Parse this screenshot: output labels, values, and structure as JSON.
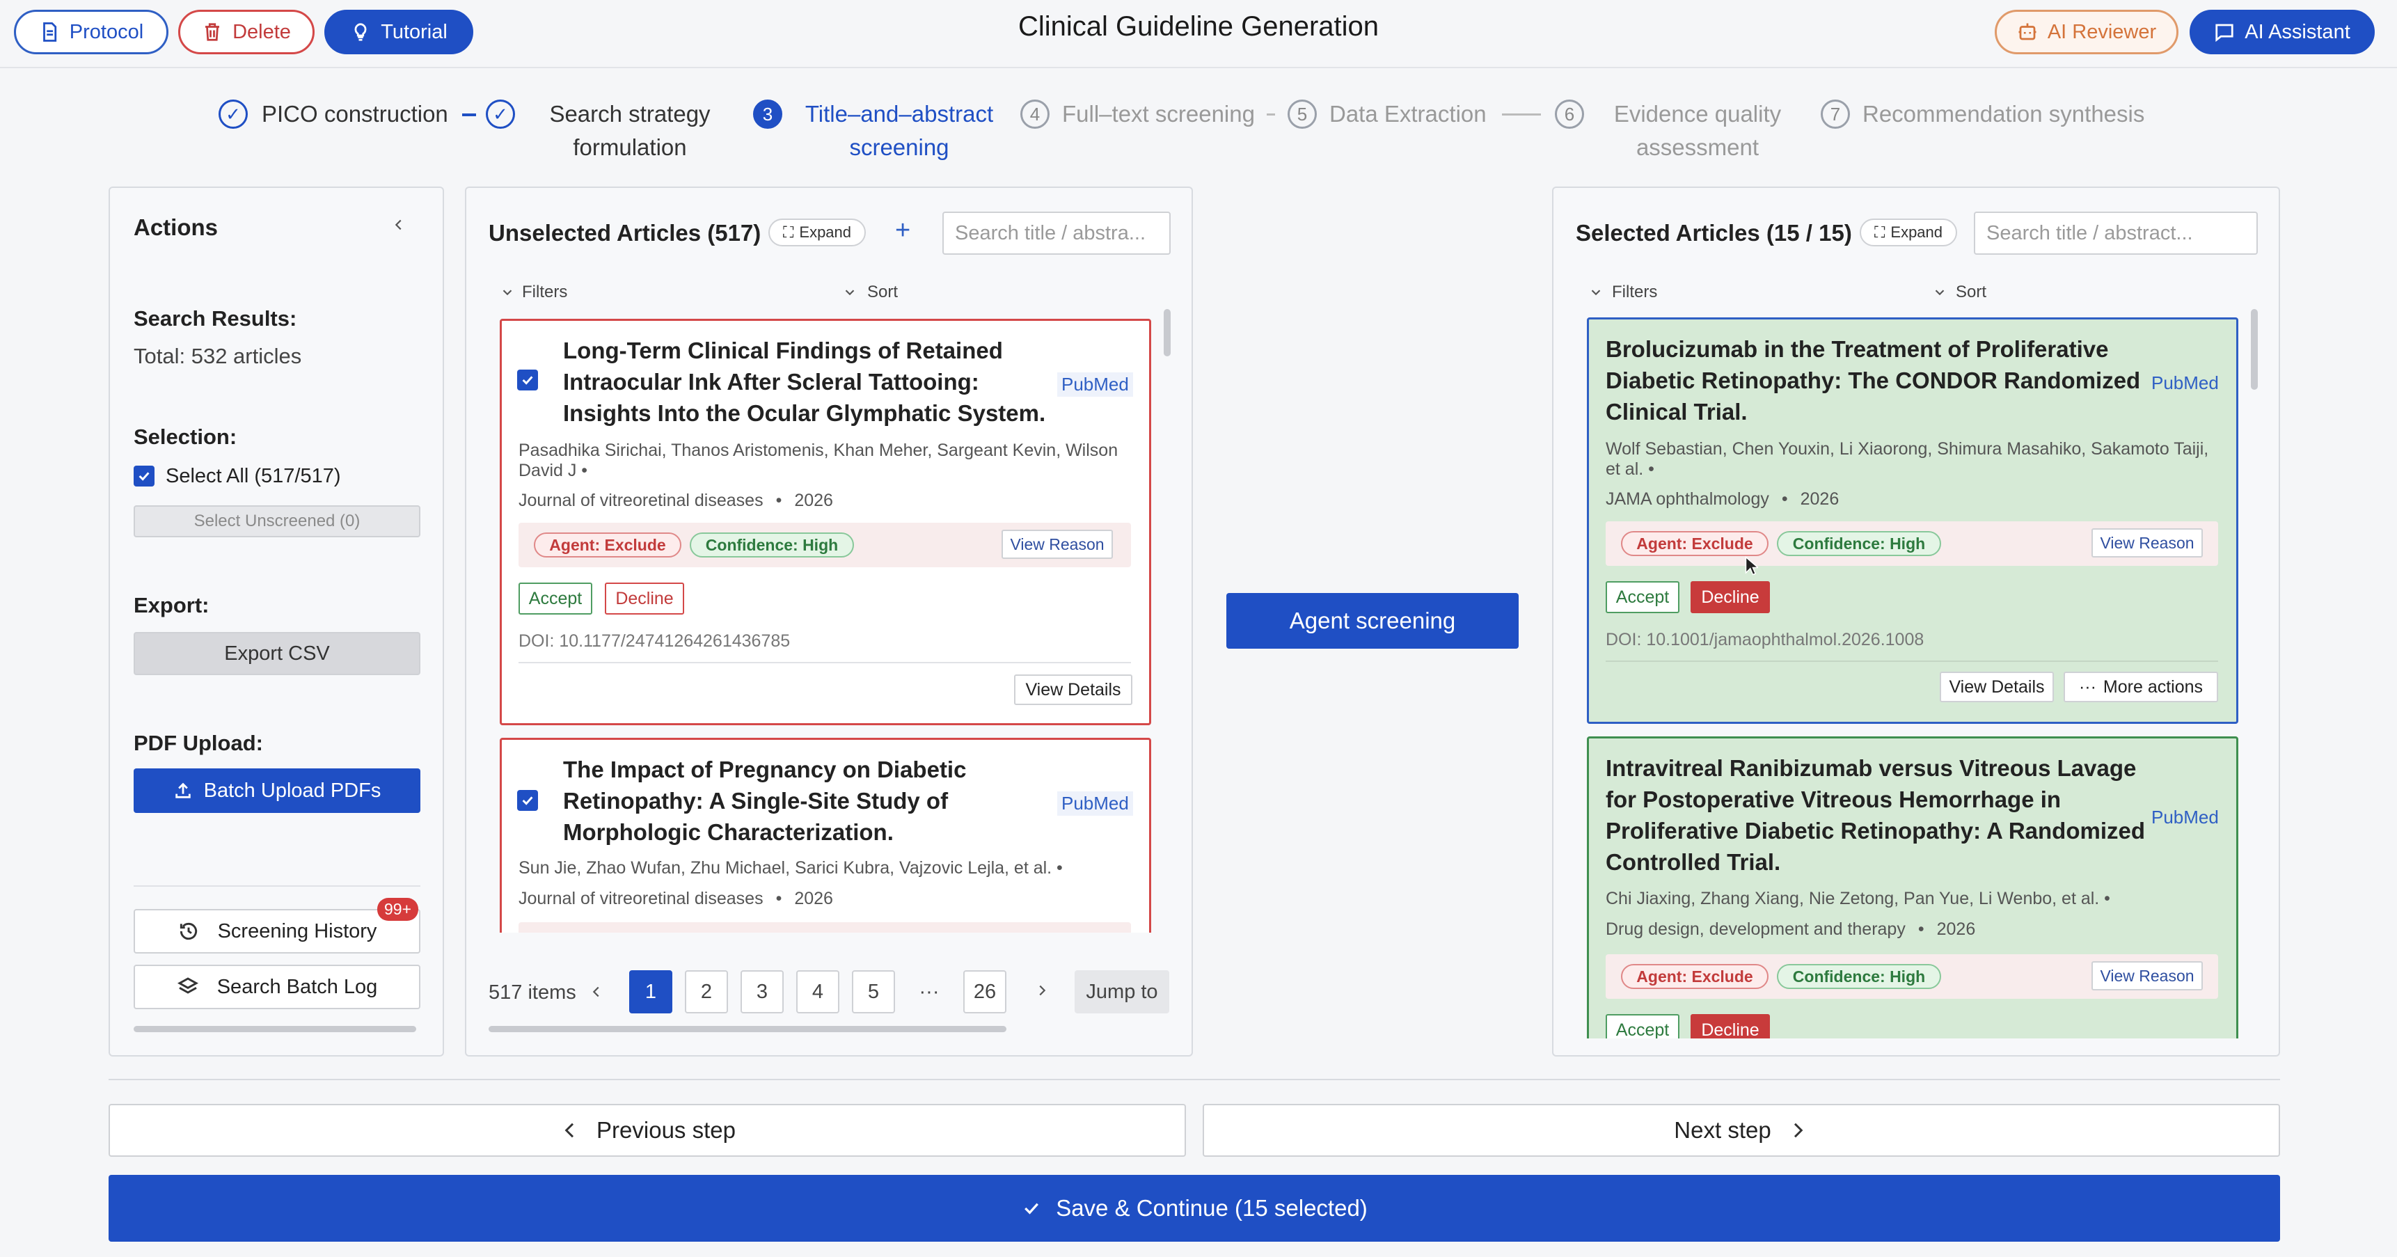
{
  "header": {
    "title": "Clinical Guideline Generation",
    "protocol_label": "Protocol",
    "delete_label": "Delete",
    "tutorial_label": "Tutorial",
    "ai_reviewer_label": "AI Reviewer",
    "ai_assistant_label": "AI Assistant"
  },
  "steps": [
    {
      "num": "1",
      "label1": "PICO construction",
      "label2": "",
      "state": "done"
    },
    {
      "num": "2",
      "label1": "Search strategy",
      "label2": "formulation",
      "state": "done"
    },
    {
      "num": "3",
      "label1": "Title–and–abstract",
      "label2": "screening",
      "state": "current"
    },
    {
      "num": "4",
      "label1": "Full–text screening",
      "label2": "",
      "state": "todo"
    },
    {
      "num": "5",
      "label1": "Data Extraction",
      "label2": "",
      "state": "todo"
    },
    {
      "num": "6",
      "label1": "Evidence quality",
      "label2": "assessment",
      "state": "todo"
    },
    {
      "num": "7",
      "label1": "Recommendation synthesis",
      "label2": "",
      "state": "todo"
    }
  ],
  "actions": {
    "title": "Actions",
    "search_results_label": "Search Results:",
    "total": "Total: 532 articles",
    "selection_label": "Selection:",
    "select_all": "Select All (517/517)",
    "select_unscreened": "Select Unscreened (0)",
    "export_label": "Export:",
    "export_csv": "Export CSV",
    "pdf_label": "PDF Upload:",
    "batch_upload": "Batch Upload PDFs",
    "screening_history": "Screening History",
    "history_badge": "99+",
    "search_batch_log": "Search Batch Log"
  },
  "unselected": {
    "title": "Unselected Articles (517)",
    "expand": "Expand",
    "search_placeholder": "Search title / abstra...",
    "filters": "Filters",
    "sort": "Sort",
    "articles": [
      {
        "title_l1": "Long-Term Clinical Findings of Retained",
        "title_l2": "Intraocular Ink After Scleral Tattooing:",
        "title_l3": "Insights Into the Ocular Glymphatic System.",
        "source": "PubMed",
        "authors_l1": "Pasadhika Sirichai, Thanos Aristomenis, Khan Meher, Sargeant Kevin, Wilson",
        "authors_l2": "David J  •",
        "journal": "Journal of vitreoretinal diseases",
        "year": "2026",
        "agent": "Agent: Exclude",
        "confidence": "Confidence: High",
        "view_reason": "View Reason",
        "accept": "Accept",
        "decline": "Decline",
        "doi": "DOI: 10.1177/24741264261436785",
        "view_details": "View Details"
      },
      {
        "title_l1": "The Impact of Pregnancy on Diabetic",
        "title_l2": "Retinopathy: A Single-Site Study of",
        "title_l3": "Morphologic Characterization.",
        "source": "PubMed",
        "authors_l1": "Sun Jie, Zhao Wufan, Zhu Michael, Sarici Kubra, Vajzovic Lejla, et al.  •",
        "journal": "Journal of vitreoretinal diseases",
        "year": "2026"
      }
    ],
    "pagination": {
      "count": "517 items",
      "pages": [
        "1",
        "2",
        "3",
        "4",
        "5",
        "···",
        "26"
      ],
      "current": "1",
      "jump": "Jump to"
    }
  },
  "agent_screening": "Agent screening",
  "selected": {
    "title": "Selected Articles (15 / 15)",
    "expand": "Expand",
    "search_placeholder": "Search title / abstract...",
    "filters": "Filters",
    "sort": "Sort",
    "articles": [
      {
        "title_l1": "Brolucizumab in the Treatment of Proliferative",
        "title_l2": "Diabetic Retinopathy: The CONDOR Randomized",
        "title_l3": "Clinical Trial.",
        "source": "PubMed",
        "authors_l1": "Wolf Sebastian, Chen Youxin, Li Xiaorong, Shimura Masahiko, Sakamoto Taiji,",
        "authors_l2": "et al.  •",
        "journal": "JAMA ophthalmology",
        "year": "2026",
        "agent": "Agent: Exclude",
        "confidence": "Confidence: High",
        "view_reason": "View Reason",
        "accept": "Accept",
        "decline": "Decline",
        "doi": "DOI: 10.1001/jamaophthalmol.2026.1008",
        "view_details": "View Details",
        "more_actions": "More actions"
      },
      {
        "title_l1": "Intravitreal Ranibizumab versus Vitreous Lavage",
        "title_l2": "for Postoperative Vitreous Hemorrhage in",
        "title_l3": "Proliferative Diabetic Retinopathy: A Randomized",
        "title_l4": "Controlled Trial.",
        "source": "PubMed",
        "authors_l1": "Chi Jiaxing, Zhang Xiang, Nie Zetong, Pan Yue, Li Wenbo, et al.  •",
        "journal": "Drug design, development and therapy",
        "year": "2026",
        "agent": "Agent: Exclude",
        "confidence": "Confidence: High",
        "view_reason": "View Reason",
        "accept": "Accept",
        "decline": "Decline"
      }
    ]
  },
  "footer": {
    "previous": "Previous step",
    "next": "Next step",
    "save": "Save & Continue (15 selected)"
  },
  "colors": {
    "primary": "#1f4fc4",
    "danger": "#d44848",
    "success": "#2d7a3e",
    "selected_bg": "#d6ead6"
  }
}
